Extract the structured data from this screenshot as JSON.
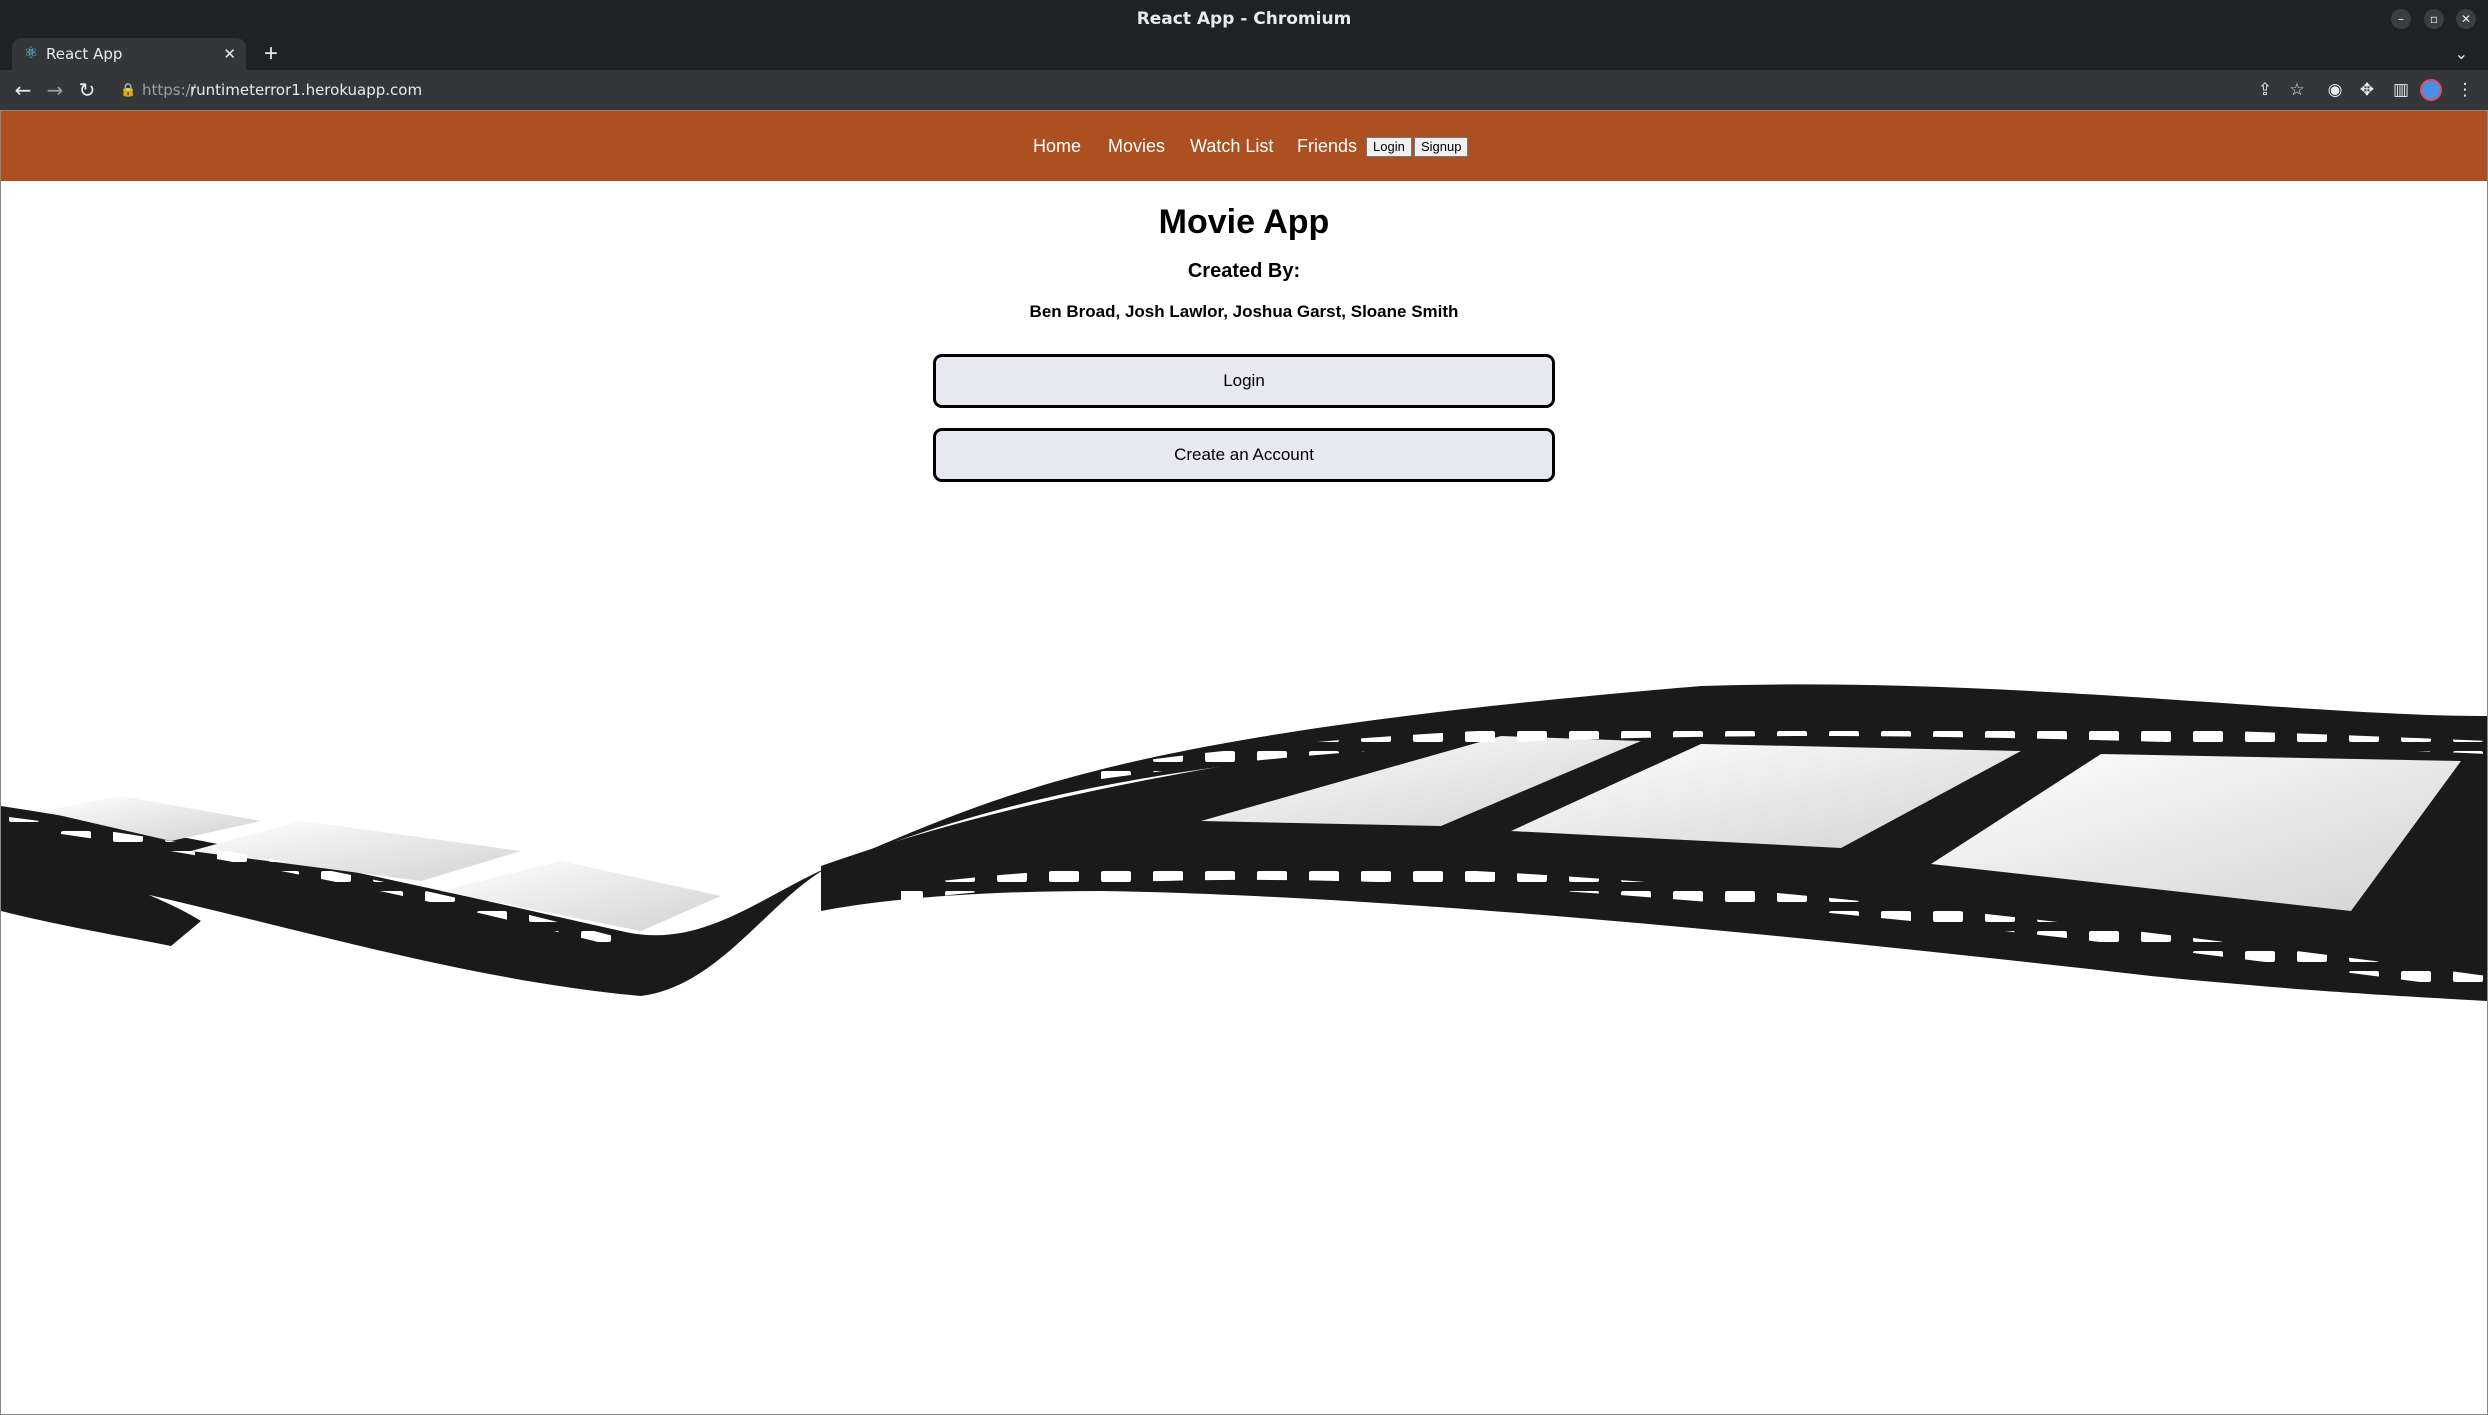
{
  "browser": {
    "window_title": "React App - Chromium",
    "tab_title": "React App",
    "url_scheme": "https://",
    "url_host": "runtimeterror1.herokuapp.com"
  },
  "nav": {
    "links": [
      "Home",
      "Movies",
      "Watch List",
      "Friends"
    ],
    "login_label": "Login",
    "signup_label": "Signup"
  },
  "main": {
    "title": "Movie App",
    "created_by_label": "Created By:",
    "authors": "Ben Broad, Josh Lawlor, Joshua Garst, Sloane Smith",
    "login_button": "Login",
    "create_account_button": "Create an Account"
  },
  "colors": {
    "nav_background": "#ac5022",
    "button_background": "#e8e8f0"
  },
  "icons": {
    "favicon": "react-icon",
    "back": "back-arrow-icon",
    "forward": "forward-arrow-icon",
    "reload": "reload-icon",
    "share": "share-icon",
    "bookmark": "star-icon",
    "extensions": "puzzle-icon"
  }
}
